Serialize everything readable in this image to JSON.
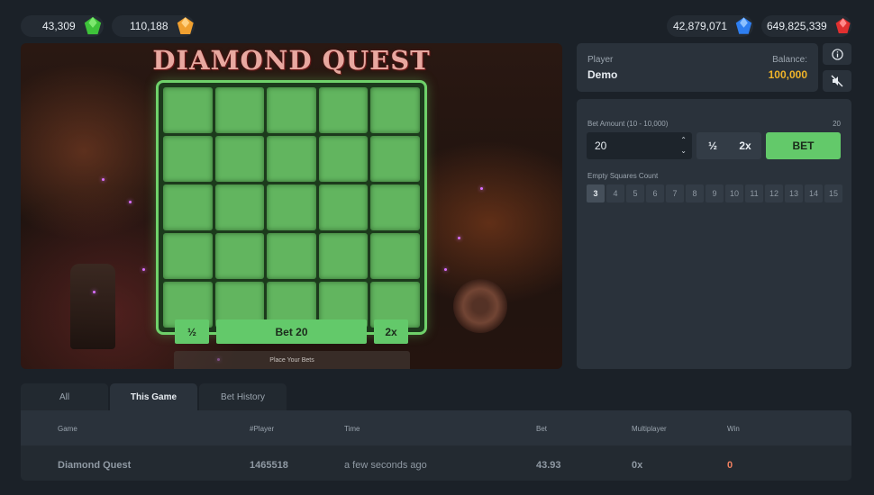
{
  "jackpots": [
    {
      "value": "43,309",
      "gem": "green-gem-icon",
      "color": "#3ec23a"
    },
    {
      "value": "110,188",
      "gem": "orange-gem-icon",
      "color": "#f0a030"
    },
    {
      "value": "42,879,071",
      "gem": "blue-gem-icon",
      "color": "#2e7ef0"
    },
    {
      "value": "649,825,339",
      "gem": "red-gem-icon",
      "color": "#e03030"
    }
  ],
  "game": {
    "title": "DIAMOND QUEST",
    "half_label": "½",
    "bet_label": "Bet 20",
    "double_label": "2x",
    "hint": "Place Your Bets"
  },
  "player": {
    "player_label": "Player",
    "player_name": "Demo",
    "balance_label": "Balance:",
    "balance_value": "100,000",
    "balance_color": "#f0b429"
  },
  "bet_panel": {
    "amount_label": "Bet Amount (10 - 10,000)",
    "amount_right": "20",
    "amount_value": "20",
    "half_label": "½",
    "double_label": "2x",
    "bet_button": "BET",
    "squares_label": "Empty Squares Count",
    "squares": [
      "3",
      "4",
      "5",
      "6",
      "7",
      "8",
      "9",
      "10",
      "11",
      "12",
      "13",
      "14",
      "15"
    ],
    "selected_square": "3"
  },
  "tabs": [
    {
      "label": "All",
      "active": false
    },
    {
      "label": "This Game",
      "active": true
    },
    {
      "label": "Bet History",
      "active": false
    }
  ],
  "table": {
    "headers": [
      "Game",
      "#Player",
      "Time",
      "Bet",
      "Multiplayer",
      "Win"
    ],
    "rows": [
      [
        "Diamond Quest",
        "1465518",
        "a few seconds ago",
        "43.93",
        "0x",
        "0"
      ]
    ],
    "win_color": "#f08060"
  }
}
